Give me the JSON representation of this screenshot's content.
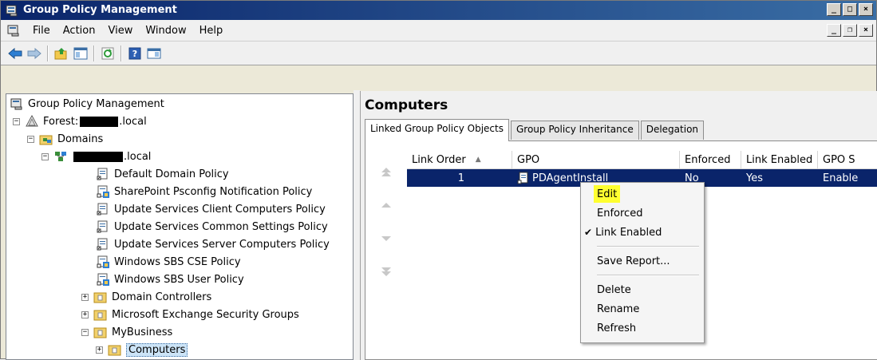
{
  "window": {
    "title": "Group Policy Management"
  },
  "menu": {
    "items": [
      "File",
      "Action",
      "View",
      "Window",
      "Help"
    ]
  },
  "tree": {
    "root": "Group Policy Management",
    "forest_prefix": "Forest: ",
    "forest_suffix": ".local",
    "domains": "Domains",
    "domain_suffix": ".local",
    "gpos": [
      "Default Domain Policy",
      "SharePoint Psconfig Notification Policy",
      "Update Services Client Computers Policy",
      "Update Services Common Settings Policy",
      "Update Services Server Computers Policy",
      "Windows SBS CSE Policy",
      "Windows SBS User Policy"
    ],
    "ous": [
      "Domain Controllers",
      "Microsoft Exchange Security Groups",
      "MyBusiness"
    ],
    "child_ou": "Computers"
  },
  "right_pane": {
    "title": "Computers",
    "tabs": [
      "Linked Group Policy Objects",
      "Group Policy Inheritance",
      "Delegation"
    ],
    "columns": [
      "Link Order",
      "GPO",
      "Enforced",
      "Link Enabled",
      "GPO S"
    ],
    "rows": [
      {
        "link_order": "1",
        "gpo": "PDAgentInstall",
        "enforced": "No",
        "link_enabled": "Yes",
        "gpo_status": "Enable"
      }
    ]
  },
  "context_menu": {
    "edit": "Edit",
    "enforced": "Enforced",
    "link_enabled": "Link Enabled",
    "save_report": "Save Report...",
    "delete": "Delete",
    "rename": "Rename",
    "refresh": "Refresh"
  },
  "colors": {
    "selection": "#0a246a",
    "highlight": "#ffff30"
  }
}
